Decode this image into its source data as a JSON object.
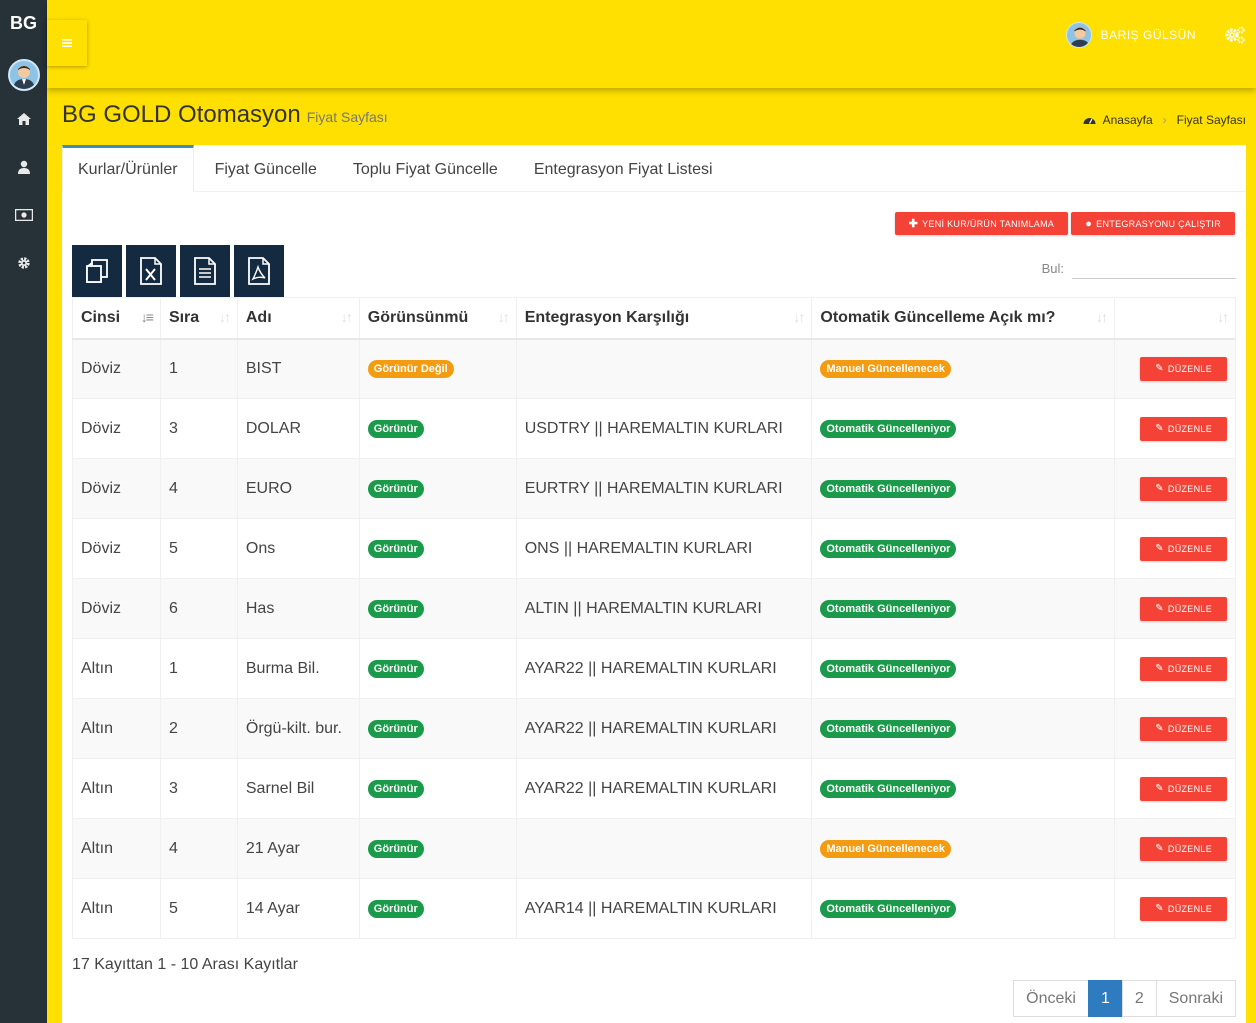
{
  "app": {
    "logo": "BG"
  },
  "header": {
    "user_name": "BARIŞ GÜLSÜN"
  },
  "page": {
    "title": "BG GOLD Otomasyon",
    "subtitle": "Fiyat Sayfası"
  },
  "breadcrumb": {
    "home": "Anasayfa",
    "current": "Fiyat Sayfası"
  },
  "tabs": [
    "Kurlar/Ürünler",
    "Fiyat Güncelle",
    "Toplu Fiyat Güncelle",
    "Entegrasyon Fiyat Listesi"
  ],
  "actions": {
    "new_label": "YENİ KUR/ÜRÜN TANIMLAMA",
    "run_label": "ENTEGRASYONU ÇALIŞTIR"
  },
  "search": {
    "label": "Bul:",
    "value": ""
  },
  "table": {
    "headers": [
      "Cinsi",
      "Sıra",
      "Adı",
      "Görünsünmü",
      "Entegrasyon Karşılığı",
      "Otomatik Güncelleme Açık mı?",
      ""
    ],
    "edit_label": "DÜZENLE",
    "rows": [
      {
        "cinsi": "Döviz",
        "sira": "1",
        "adi": "BIST",
        "gorunum": "Görünür Değil",
        "gorunum_status": "orange",
        "entegrasyon": "",
        "otomatik": "Manuel Güncellenecek",
        "otomatik_status": "orange"
      },
      {
        "cinsi": "Döviz",
        "sira": "3",
        "adi": "DOLAR",
        "gorunum": "Görünür",
        "gorunum_status": "green",
        "entegrasyon": "USDTRY || HAREMALTIN KURLARI",
        "otomatik": "Otomatik Güncelleniyor",
        "otomatik_status": "green"
      },
      {
        "cinsi": "Döviz",
        "sira": "4",
        "adi": "EURO",
        "gorunum": "Görünür",
        "gorunum_status": "green",
        "entegrasyon": "EURTRY || HAREMALTIN KURLARI",
        "otomatik": "Otomatik Güncelleniyor",
        "otomatik_status": "green"
      },
      {
        "cinsi": "Döviz",
        "sira": "5",
        "adi": "Ons",
        "gorunum": "Görünür",
        "gorunum_status": "green",
        "entegrasyon": "ONS || HAREMALTIN KURLARI",
        "otomatik": "Otomatik Güncelleniyor",
        "otomatik_status": "green"
      },
      {
        "cinsi": "Döviz",
        "sira": "6",
        "adi": "Has",
        "gorunum": "Görünür",
        "gorunum_status": "green",
        "entegrasyon": "ALTIN || HAREMALTIN KURLARI",
        "otomatik": "Otomatik Güncelleniyor",
        "otomatik_status": "green"
      },
      {
        "cinsi": "Altın",
        "sira": "1",
        "adi": "Burma Bil.",
        "gorunum": "Görünür",
        "gorunum_status": "green",
        "entegrasyon": "AYAR22 || HAREMALTIN KURLARI",
        "otomatik": "Otomatik Güncelleniyor",
        "otomatik_status": "green"
      },
      {
        "cinsi": "Altın",
        "sira": "2",
        "adi": "Örgü-kilt. bur.",
        "gorunum": "Görünür",
        "gorunum_status": "green",
        "entegrasyon": "AYAR22 || HAREMALTIN KURLARI",
        "otomatik": "Otomatik Güncelleniyor",
        "otomatik_status": "green"
      },
      {
        "cinsi": "Altın",
        "sira": "3",
        "adi": "Sarnel Bil",
        "gorunum": "Görünür",
        "gorunum_status": "green",
        "entegrasyon": "AYAR22 || HAREMALTIN KURLARI",
        "otomatik": "Otomatik Güncelleniyor",
        "otomatik_status": "green"
      },
      {
        "cinsi": "Altın",
        "sira": "4",
        "adi": "21 Ayar",
        "gorunum": "Görünür",
        "gorunum_status": "green",
        "entegrasyon": "",
        "otomatik": "Manuel Güncellenecek",
        "otomatik_status": "orange"
      },
      {
        "cinsi": "Altın",
        "sira": "5",
        "adi": "14 Ayar",
        "gorunum": "Görünür",
        "gorunum_status": "green",
        "entegrasyon": "AYAR14 || HAREMALTIN KURLARI",
        "otomatik": "Otomatik Güncelleniyor",
        "otomatik_status": "green"
      }
    ]
  },
  "footer": {
    "info": "17 Kayıttan 1 - 10 Arası Kayıtlar"
  },
  "pagination": {
    "prev": "Önceki",
    "pages": [
      "1",
      "2"
    ],
    "active": "1",
    "next": "Sonraki"
  },
  "colors": {
    "header": "#FFE000",
    "sidebar": "#263238",
    "danger": "#f44336",
    "success": "#1a9a4a",
    "warning": "#f39c12",
    "primary": "#2f7bbf"
  }
}
